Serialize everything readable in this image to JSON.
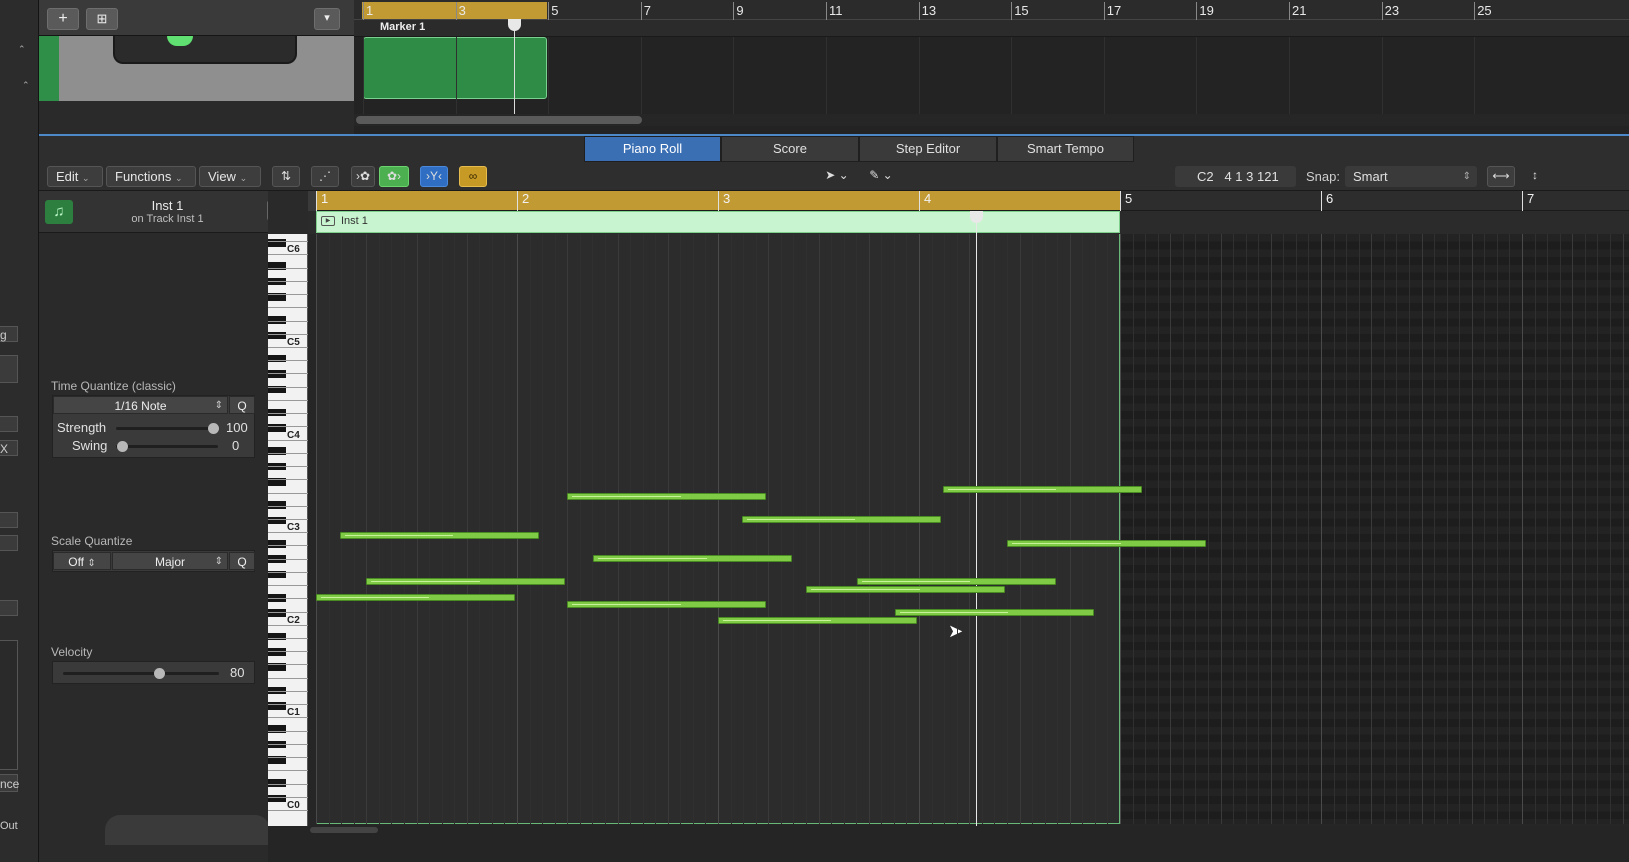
{
  "left_strip": {
    "texts": [
      "g",
      "X",
      "nce",
      "Out"
    ]
  },
  "tracks": {
    "add_label": "+",
    "dup_label": "⊞",
    "menu_label": "▾",
    "ruler_numbers": [
      "1",
      "3",
      "5",
      "7",
      "9",
      "11",
      "13",
      "15",
      "17",
      "19",
      "21",
      "23",
      "25"
    ],
    "marker_label": "Marker 1"
  },
  "tabs": [
    "Piano Roll",
    "Score",
    "Step Editor",
    "Smart Tempo"
  ],
  "active_tab": "Piano Roll",
  "toolbar": {
    "edit": "Edit",
    "functions": "Functions",
    "view": "View",
    "position_note": "C2",
    "position_value": "4 1 3 121",
    "snap_label": "Snap:",
    "snap_value": "Smart"
  },
  "inspector": {
    "instrument_name": "Inst 1",
    "instrument_sub": "on Track Inst 1",
    "time_quantize_label": "Time Quantize (classic)",
    "quantize_value": "1/16 Note",
    "q_label": "Q",
    "strength_label": "Strength",
    "strength_value": "100",
    "swing_label": "Swing",
    "swing_value": "0",
    "scale_quantize_label": "Scale Quantize",
    "scale_off": "Off",
    "scale_major": "Major",
    "velocity_label": "Velocity",
    "velocity_value": "80"
  },
  "keyboard_labels": [
    "C6",
    "C5",
    "C4",
    "C3",
    "C2",
    "C1",
    "C0"
  ],
  "piano_roll": {
    "ruler_numbers": [
      "1",
      "2",
      "3",
      "4",
      "5",
      "6",
      "7"
    ],
    "region_name": "Inst 1",
    "notes": [
      {
        "start_bar": 1.0,
        "length_bars": 0.99,
        "pitch": "D#2"
      },
      {
        "start_bar": 1.12,
        "length_bars": 0.99,
        "pitch": "B2"
      },
      {
        "start_bar": 1.25,
        "length_bars": 0.99,
        "pitch": "F2"
      },
      {
        "start_bar": 2.25,
        "length_bars": 0.99,
        "pitch": "E3"
      },
      {
        "start_bar": 2.25,
        "length_bars": 0.99,
        "pitch": "D2"
      },
      {
        "start_bar": 2.38,
        "length_bars": 0.99,
        "pitch": "G#2"
      },
      {
        "start_bar": 3.0,
        "length_bars": 0.99,
        "pitch": "C2"
      },
      {
        "start_bar": 3.12,
        "length_bars": 0.99,
        "pitch": "C#3"
      },
      {
        "start_bar": 3.44,
        "length_bars": 0.99,
        "pitch": "E2"
      },
      {
        "start_bar": 3.69,
        "length_bars": 0.99,
        "pitch": "F2"
      },
      {
        "start_bar": 3.88,
        "length_bars": 0.99,
        "pitch": "C#2"
      },
      {
        "start_bar": 4.12,
        "length_bars": 0.99,
        "pitch": "F3"
      },
      {
        "start_bar": 4.44,
        "length_bars": 0.99,
        "pitch": "A#2"
      }
    ]
  },
  "colors": {
    "accent_blue": "#3b6fb4",
    "cycle_gold": "#c19a33",
    "note_green": "#7fcb46",
    "region_green": "#2e8c46"
  }
}
